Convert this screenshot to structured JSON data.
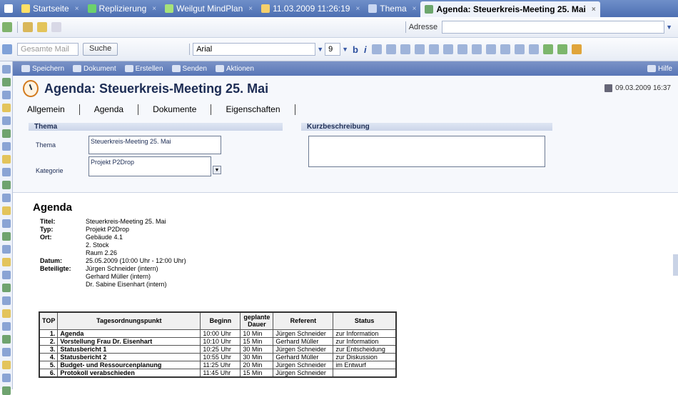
{
  "tabs": [
    {
      "label": "",
      "icon": "window-icon",
      "color": "#ffffff"
    },
    {
      "label": "Startseite",
      "icon": "home-icon",
      "color": "#ffe066"
    },
    {
      "label": "Replizierung",
      "icon": "replication-icon",
      "color": "#6cd16c"
    },
    {
      "label": "Weilgut MindPlan",
      "icon": "mindplan-icon",
      "color": "#a6e27a"
    },
    {
      "label": "11.03.2009 11:26:19",
      "icon": "document-icon",
      "color": "#f5d06b"
    },
    {
      "label": "Thema",
      "icon": "calendar-icon",
      "color": "#c9d7f2"
    },
    {
      "label": "Agenda: Steuerkreis-Meeting 25. Mai",
      "icon": "agenda-icon",
      "color": "#6ca66c",
      "active": true
    }
  ],
  "toolbar1": {
    "address_label": "Adresse",
    "address_value": ""
  },
  "toolbar2": {
    "search_placeholder": "Gesamte Mail",
    "search_button": "Suche",
    "font": "Arial",
    "size": "9",
    "format_buttons": [
      "b",
      "i"
    ]
  },
  "actions": [
    {
      "label": "Speichern",
      "icon": "save-icon"
    },
    {
      "label": "Dokument",
      "icon": "document-icon"
    },
    {
      "label": "Erstellen",
      "icon": "create-icon"
    },
    {
      "label": "Senden",
      "icon": "send-icon"
    },
    {
      "label": "Aktionen",
      "icon": "actions-icon"
    }
  ],
  "help": "Hilfe",
  "form": {
    "title": "Agenda: Steuerkreis-Meeting 25. Mai",
    "date": "09.03.2009 16:37",
    "tabs": [
      "Allgemein",
      "Agenda",
      "Dokumente",
      "Eigenschaften"
    ],
    "section_thema": "Thema",
    "section_kurz": "Kurzbeschreibung",
    "label_thema": "Thema",
    "value_thema": "Steuerkreis-Meeting 25. Mai",
    "label_kategorie": "Kategorie",
    "value_kategorie": "Projekt P2Drop"
  },
  "agenda": {
    "heading": "Agenda",
    "meta": [
      {
        "k": "Titel:",
        "v": "Steuerkreis-Meeting 25. Mai"
      },
      {
        "k": "Typ:",
        "v": "Projekt P2Drop"
      },
      {
        "k": "Ort:",
        "v": "Gebäude 4.1"
      },
      {
        "k": "",
        "v": "2. Stock"
      },
      {
        "k": "",
        "v": "Raum 2.26"
      },
      {
        "k": "Datum:",
        "v": "25.05.2009 (10:00 Uhr - 12:00 Uhr)"
      },
      {
        "k": "Beteiligte:",
        "v": "Jürgen Schneider (intern)"
      },
      {
        "k": "",
        "v": "Gerhard Müller (intern)"
      },
      {
        "k": "",
        "v": "Dr. Sabine Eisenhart (intern)"
      }
    ],
    "table": {
      "headers": [
        "TOP",
        "Tagesordnungspunkt",
        "Beginn",
        "geplante Dauer",
        "Referent",
        "Status"
      ],
      "rows": [
        [
          "1.",
          "Agenda",
          "10:00 Uhr",
          "10 Min",
          "Jürgen Schneider",
          "zur Information"
        ],
        [
          "2.",
          "Vorstellung Frau Dr. Eisenhart",
          "10:10 Uhr",
          "15 Min",
          "Gerhard Müller",
          "zur Information"
        ],
        [
          "3.",
          "Statusbericht 1",
          "10:25 Uhr",
          "30 Min",
          "Jürgen Schneider",
          "zur Entscheidung"
        ],
        [
          "4.",
          "Statusbericht 2",
          "10:55 Uhr",
          "30 Min",
          "Gerhard Müller",
          "zur Diskussion"
        ],
        [
          "5.",
          "Budget- und Ressourcenplanung",
          "11:25 Uhr",
          "20 Min",
          "Jürgen Schneider",
          "im Entwurf"
        ],
        [
          "6.",
          "Protokoll verabschieden",
          "11:45 Uhr",
          "15 Min",
          "Jürgen Schneider",
          ""
        ]
      ]
    }
  },
  "sidebar_icons": [
    "search-icon",
    "calendar-icon",
    "mail-icon",
    "calendar-icon",
    "document-icon",
    "document-icon",
    "check-icon",
    "sync-icon",
    "circle-icon",
    "folder-icon",
    "table-icon",
    "folder-icon",
    "folder-icon",
    "folder-icon",
    "search-icon",
    "document-icon",
    "document-icon",
    "folder-icon",
    "person-icon",
    "person-icon",
    "person-icon",
    "person-icon",
    "globe-icon",
    "network-icon",
    "help-icon",
    "settings-icon"
  ]
}
